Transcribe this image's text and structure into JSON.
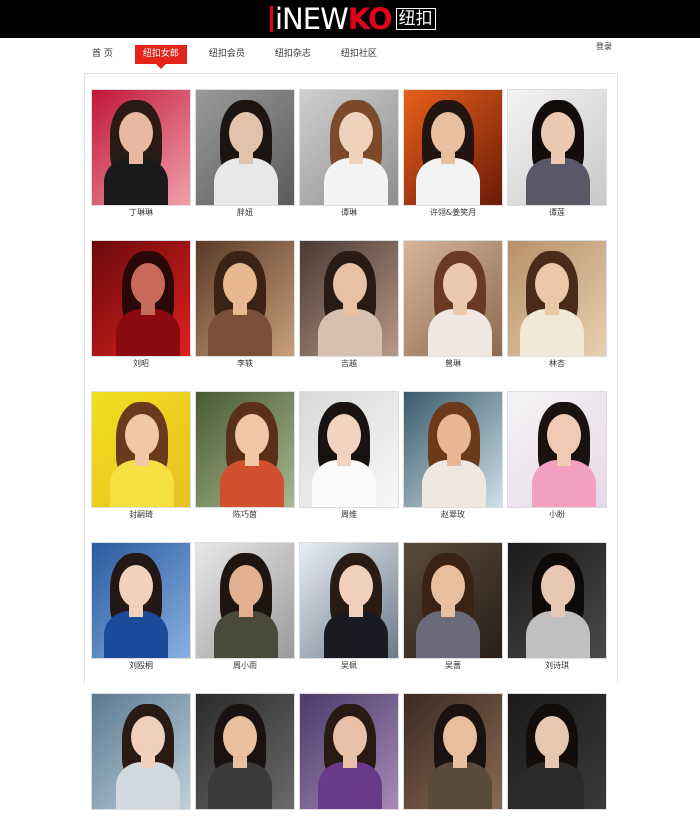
{
  "header": {
    "logo_a": "iNEW",
    "logo_b": "KO",
    "logo_c": "纽扣"
  },
  "nav": {
    "items": [
      "首 页",
      "纽扣女郎",
      "纽扣会员",
      "纽扣杂志",
      "纽扣社区"
    ],
    "active_index": 1
  },
  "login": "登录",
  "colors": {
    "brand_red": "#e4241b",
    "header_bg": "#000000"
  },
  "gallery": [
    {
      "name": "丁琳琳",
      "bg": [
        "#c2163a",
        "#f0a0a8"
      ],
      "skin": "#e8b8a0",
      "hair": "#2a1a14",
      "cloth": "#1a1a1a"
    },
    {
      "name": "胖妞",
      "bg": [
        "#9a9a9a",
        "#5a5a5a"
      ],
      "skin": "#e2c2aa",
      "hair": "#1c1410",
      "cloth": "#e8e8e8"
    },
    {
      "name": "谭琳",
      "bg": [
        "#cfcfcf",
        "#8e8e8e"
      ],
      "skin": "#f0d2bc",
      "hair": "#7a4a2a",
      "cloth": "#f4f4f4"
    },
    {
      "name": "许翎&姜笑月",
      "bg": [
        "#e8601a",
        "#6a1a08"
      ],
      "skin": "#e8c0a0",
      "hair": "#241410",
      "cloth": "#f2f2f2"
    },
    {
      "name": "谭莲",
      "bg": [
        "#f4f4f4",
        "#c8c8c8"
      ],
      "skin": "#ecc8b0",
      "hair": "#120c0a",
      "cloth": "#585868"
    },
    {
      "name": "刘昭",
      "bg": [
        "#6a0a0a",
        "#e02020"
      ],
      "skin": "#c86a5a",
      "hair": "#2a0808",
      "cloth": "#8a0a10"
    },
    {
      "name": "李轶",
      "bg": [
        "#5a3a28",
        "#c8a07a"
      ],
      "skin": "#e8b890",
      "hair": "#3a2214",
      "cloth": "#7a5038"
    },
    {
      "name": "吉越",
      "bg": [
        "#4a3a32",
        "#b89888"
      ],
      "skin": "#e8c0a4",
      "hair": "#2a1a14",
      "cloth": "#d8c0b0"
    },
    {
      "name": "曾琳",
      "bg": [
        "#d8b498",
        "#8a6a52"
      ],
      "skin": "#ecc8ac",
      "hair": "#6a3a22",
      "cloth": "#f0e8e0"
    },
    {
      "name": "林杏",
      "bg": [
        "#b8906a",
        "#e8d0b0"
      ],
      "skin": "#ecc8a8",
      "hair": "#4a2a18",
      "cloth": "#f2e8d8"
    },
    {
      "name": "封嗣琦",
      "bg": [
        "#f0e020",
        "#e8c020"
      ],
      "skin": "#f0c8a8",
      "hair": "#6a3a1e",
      "cloth": "#f4e040"
    },
    {
      "name": "陈巧茵",
      "bg": [
        "#4a5a30",
        "#a8b890"
      ],
      "skin": "#f0c8a8",
      "hair": "#5a3018",
      "cloth": "#d05030"
    },
    {
      "name": "周维",
      "bg": [
        "#d8d8d8",
        "#f8f8f8"
      ],
      "skin": "#f2d2c0",
      "hair": "#1a1210",
      "cloth": "#fafafa"
    },
    {
      "name": "赵翠玫",
      "bg": [
        "#3a5a6a",
        "#d0e0e8"
      ],
      "skin": "#e8b894",
      "hair": "#6a3a1a",
      "cloth": "#f0e8e0"
    },
    {
      "name": "小盼",
      "bg": [
        "#f4f4f4",
        "#e8d8e8"
      ],
      "skin": "#f0cab4",
      "hair": "#1a1210",
      "cloth": "#f2a0c0"
    },
    {
      "name": "刘殴桐",
      "bg": [
        "#2a5aa0",
        "#8ab0e0"
      ],
      "skin": "#f2d0bc",
      "hair": "#241814",
      "cloth": "#1a4a9a"
    },
    {
      "name": "周小雨",
      "bg": [
        "#e8e8e8",
        "#9a9a9a"
      ],
      "skin": "#e0b090",
      "hair": "#1e1410",
      "cloth": "#4a4a3a"
    },
    {
      "name": "吴佩",
      "bg": [
        "#e8eef4",
        "#6a7a8a"
      ],
      "skin": "#f0d0bc",
      "hair": "#2a1a14",
      "cloth": "#1a1a22"
    },
    {
      "name": "吴蔷",
      "bg": [
        "#5a4a3a",
        "#2a1e16"
      ],
      "skin": "#e8c0a0",
      "hair": "#3a2214",
      "cloth": "#6a6a7a"
    },
    {
      "name": "刘诗琪",
      "bg": [
        "#1a1a1a",
        "#4a4a4a"
      ],
      "skin": "#e8c8b4",
      "hair": "#0e0a08",
      "cloth": "#c0c0c0"
    },
    {
      "name": "",
      "bg": [
        "#5a7a90",
        "#c0d0dc"
      ],
      "skin": "#f0d0bc",
      "hair": "#2a1a14",
      "cloth": "#d0d8e0"
    },
    {
      "name": "",
      "bg": [
        "#2a2a2a",
        "#6a6a6a"
      ],
      "skin": "#e8c0a0",
      "hair": "#1a1210",
      "cloth": "#3a3a3a"
    },
    {
      "name": "",
      "bg": [
        "#4a3a6a",
        "#a88ab8"
      ],
      "skin": "#e8c0a8",
      "hair": "#2a1a14",
      "cloth": "#6a3a8a"
    },
    {
      "name": "",
      "bg": [
        "#3a2a22",
        "#8a6a52"
      ],
      "skin": "#e8c0a0",
      "hair": "#1a1210",
      "cloth": "#5a4a3a"
    },
    {
      "name": "",
      "bg": [
        "#1a1a1a",
        "#3a3a3a"
      ],
      "skin": "#e8c8b0",
      "hair": "#120c0a",
      "cloth": "#2a2a2a"
    }
  ]
}
